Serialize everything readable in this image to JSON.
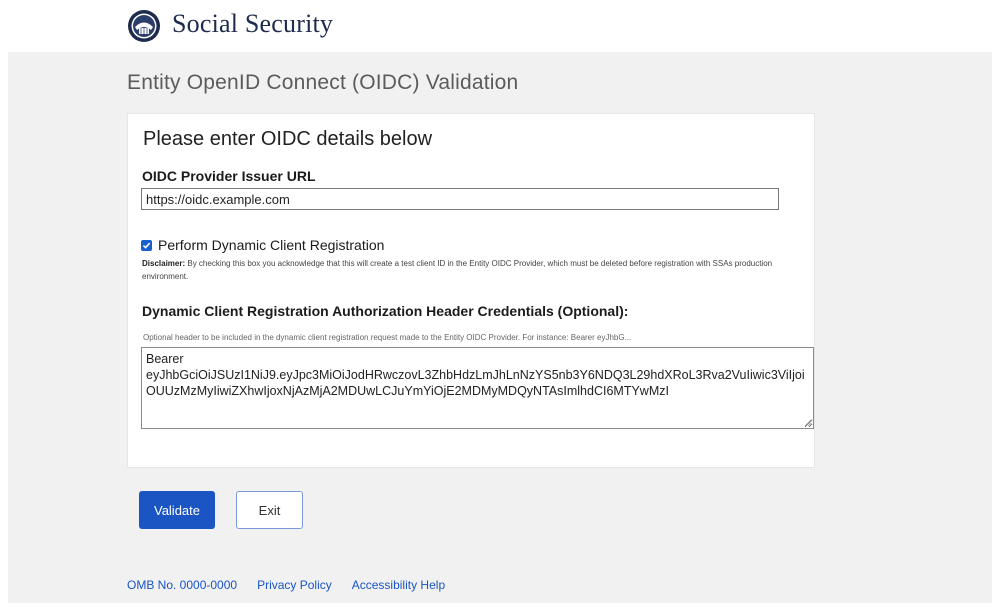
{
  "header": {
    "brand": "Social Security",
    "logo_icon": "ssa-seal-icon"
  },
  "page": {
    "title": "Entity OpenID Connect (OIDC) Validation"
  },
  "form": {
    "heading": "Please enter OIDC details below",
    "issuer": {
      "label": "OIDC Provider Issuer URL",
      "value": "https://oidc.example.com"
    },
    "dcr": {
      "checked": true,
      "label": "Perform Dynamic Client Registration",
      "disclaimer_title": "Disclaimer:",
      "disclaimer_text": "By checking this box you acknowledge that this will create a test client ID in the Entity OIDC Provider, which must be deleted before registration with SSAs production environment."
    },
    "credentials": {
      "label": "Dynamic Client Registration Authorization Header Credentials (Optional):",
      "hint": "Optional header to be included in the dynamic client registration request made to the Entity OIDC Provider. For instance: Bearer eyJhbG...",
      "value": "Bearer\neyJhbGciOiJSUzI1NiJ9.eyJpc3MiOiJodHRwczovL3ZhbHdzLmJhLnNzYS5nb3Y6NDQ3L29hdXRoL3Rva2VuIiwic3ViIjoiOUUzMzMyIiwiZXhwIjoxNjAzMjA2MDUwLCJuYmYiOjE2MDMyMDQyNTAsImlhdCI6MTYwMzI"
    }
  },
  "buttons": {
    "validate": "Validate",
    "exit": "Exit"
  },
  "footer": {
    "omb": "OMB No. 0000-0000",
    "privacy": "Privacy Policy",
    "accessibility": "Accessibility Help"
  },
  "colors": {
    "primary": "#1a55c3",
    "page_bg": "#f1f1f1",
    "brand_text": "#1e2b4d"
  }
}
